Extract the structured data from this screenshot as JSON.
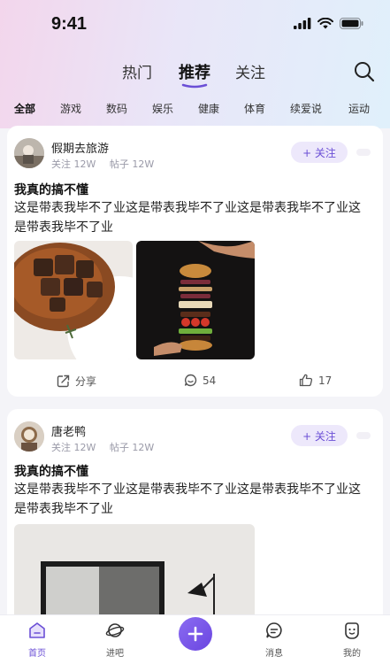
{
  "status_bar": {
    "time": "9:41"
  },
  "main_tabs": [
    {
      "label": "热门",
      "active": false
    },
    {
      "label": "推荐",
      "active": true
    },
    {
      "label": "关注",
      "active": false
    }
  ],
  "categories": [
    "全部",
    "游戏",
    "数码",
    "娱乐",
    "健康",
    "体育",
    "续爱说",
    "运动"
  ],
  "posts": [
    {
      "author": "假期去旅游",
      "meta_follow": "关注 12W",
      "meta_posts": "帖子 12W",
      "follow_label": "+ 关注",
      "title": "我真的搞不懂",
      "body": "这是带表我毕不了业这是带表我毕不了业这是带表我毕不了业这是带表我毕不了业",
      "actions": {
        "share": "分享",
        "comments": "54",
        "likes": "17"
      }
    },
    {
      "author": "唐老鸭",
      "meta_follow": "关注 12W",
      "meta_posts": "帖子 12W",
      "follow_label": "+ 关注",
      "title": "我真的搞不懂",
      "body": "这是带表我毕不了业这是带表我毕不了业这是带表我毕不了业这是带表我毕不了业"
    }
  ],
  "bottom_nav": [
    {
      "label": "首页",
      "icon": "home-icon",
      "active": true
    },
    {
      "label": "进吧",
      "icon": "planet-icon",
      "active": false
    },
    {
      "label": "",
      "icon": "plus-icon",
      "active": false
    },
    {
      "label": "消息",
      "icon": "message-icon",
      "active": false
    },
    {
      "label": "我的",
      "icon": "profile-icon",
      "active": false
    }
  ],
  "colors": {
    "accent": "#6b4fd6",
    "follow_bg": "#ede8fb",
    "page_bg": "#f4f4f8"
  }
}
